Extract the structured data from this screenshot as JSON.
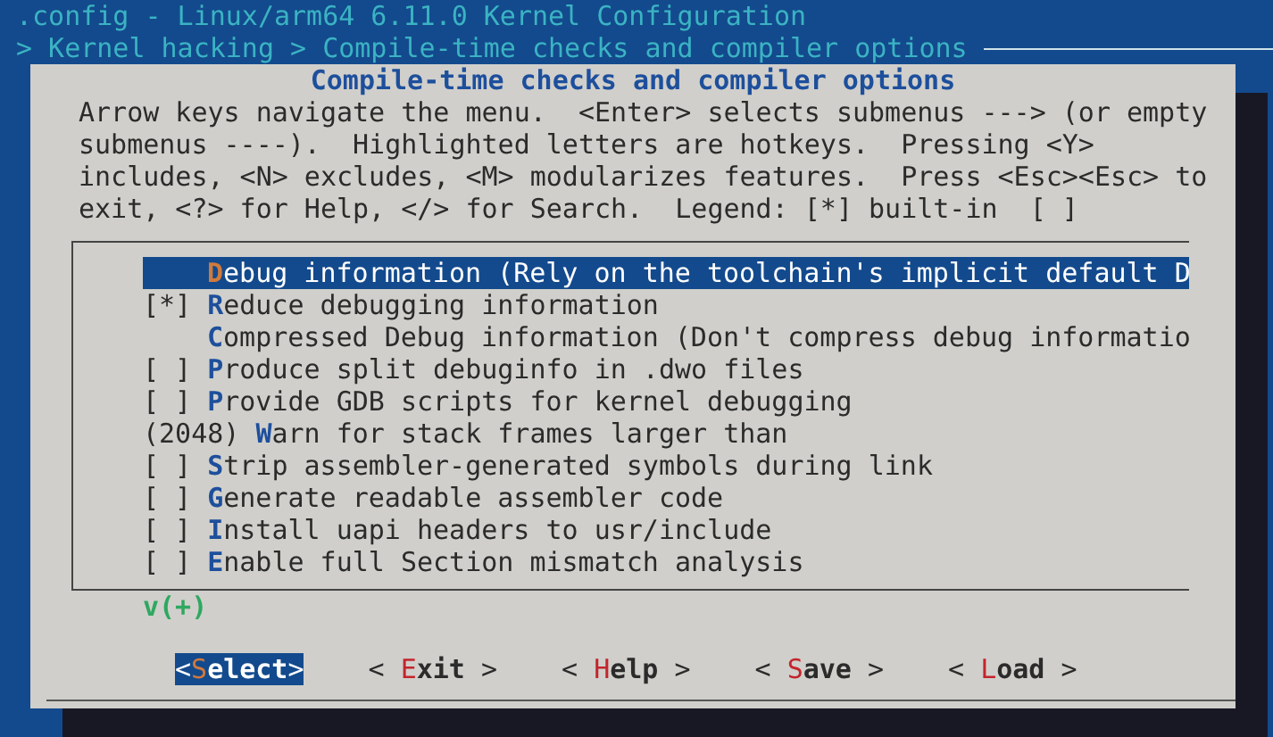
{
  "window": {
    "title": ".config - Linux/arm64 6.11.0 Kernel Configuration"
  },
  "breadcrumb": "> Kernel hacking > Compile-time checks and compiler options",
  "dialog": {
    "title": "Compile-time checks and compiler options",
    "help_lines": [
      "Arrow keys navigate the menu.  <Enter> selects submenus ---> (or empty",
      "submenus ----).  Highlighted letters are hotkeys.  Pressing <Y>",
      "includes, <N> excludes, <M> modularizes features.  Press <Esc><Esc> to",
      "exit, <?> for Help, </> for Search.  Legend: [*] built-in  [ ]"
    ],
    "items": [
      {
        "hotkey": "D",
        "label": "ebug information (Rely on the toolchain's implicit default D",
        "selected": true
      },
      {
        "prefix": "[*]",
        "hotkey": "R",
        "label": "educe debugging information",
        "selected": false
      },
      {
        "hotkey": "C",
        "label": "ompressed Debug information (Don't compress debug informatio",
        "selected": false
      },
      {
        "prefix": "[ ]",
        "hotkey": "P",
        "label": "roduce split debuginfo in .dwo files",
        "selected": false
      },
      {
        "prefix": "[ ]",
        "hotkey": "P",
        "label": "rovide GDB scripts for kernel debugging",
        "selected": false
      },
      {
        "prefix": "(2048)",
        "hotkey": "W",
        "label": "arn for stack frames larger than",
        "selected": false
      },
      {
        "prefix": "[ ]",
        "hotkey": "S",
        "label": "trip assembler-generated symbols during link",
        "selected": false
      },
      {
        "prefix": "[ ]",
        "hotkey": "G",
        "label": "enerate readable assembler code",
        "selected": false
      },
      {
        "prefix": "[ ]",
        "hotkey": "I",
        "label": "nstall uapi headers to usr/include",
        "selected": false
      },
      {
        "prefix": "[ ]",
        "hotkey": "E",
        "label": "nable full Section mismatch analysis",
        "selected": false
      }
    ],
    "more_indicator": "v(+)",
    "buttons": [
      {
        "open": "<",
        "hotkey": "S",
        "rest": "elect",
        "close": ">",
        "selected": true
      },
      {
        "open": "< ",
        "hotkey": "E",
        "rest": "xit",
        "close": " >",
        "selected": false
      },
      {
        "open": "< ",
        "hotkey": "H",
        "rest": "elp",
        "close": " >",
        "selected": false
      },
      {
        "open": "< ",
        "hotkey": "S",
        "rest": "ave",
        "close": " >",
        "selected": false
      },
      {
        "open": "< ",
        "hotkey": "L",
        "rest": "oad",
        "close": " >",
        "selected": false
      }
    ]
  }
}
